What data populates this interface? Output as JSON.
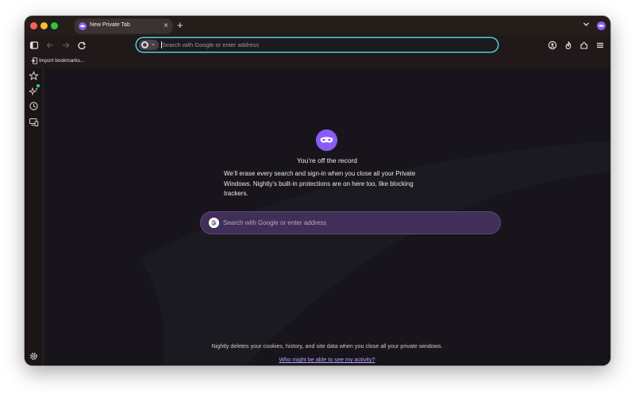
{
  "browser": {
    "tab": {
      "title": "New Private Tab",
      "close_icon": "close-icon"
    },
    "new_tab_icon": "plus-icon",
    "tabs_menu_icon": "chevron-down-icon",
    "private_indicator_icon": "private-browsing-mask-icon"
  },
  "navbar": {
    "sidebar_toggle_icon": "sidebar-icon",
    "back_icon": "back-arrow-icon",
    "forward_icon": "forward-arrow-icon",
    "reload_icon": "reload-icon",
    "url_placeholder": "Search with Google or enter address",
    "account_icon": "account-icon",
    "vpn_icon": "flame-icon",
    "extensions_icon": "puzzle-icon",
    "menu_icon": "hamburger-menu-icon"
  },
  "bookmarks": {
    "import_label": "Import bookmarks..."
  },
  "sidebar": {
    "items": [
      "star-icon",
      "ai-sparkle-icon",
      "history-icon",
      "synced-tabs-icon"
    ],
    "settings_icon": "gear-icon"
  },
  "content": {
    "title": "You’re off the record",
    "description": "We’ll erase every search and sign-in when you close all your Private Windows. Nightly’s built-in protections are on here too, like blocking trackers.",
    "search_placeholder": "Search with Google or enter address",
    "footer_note": "Nightly deletes your cookies, history, and site data when you close all your private windows.",
    "footer_link": "Who might be able to see my activity?"
  },
  "colors": {
    "accent_purple": "#8a5cf6",
    "urlbar_focus": "#4fd1d3",
    "search_box": "#402f59",
    "link": "#b9a3ff"
  }
}
